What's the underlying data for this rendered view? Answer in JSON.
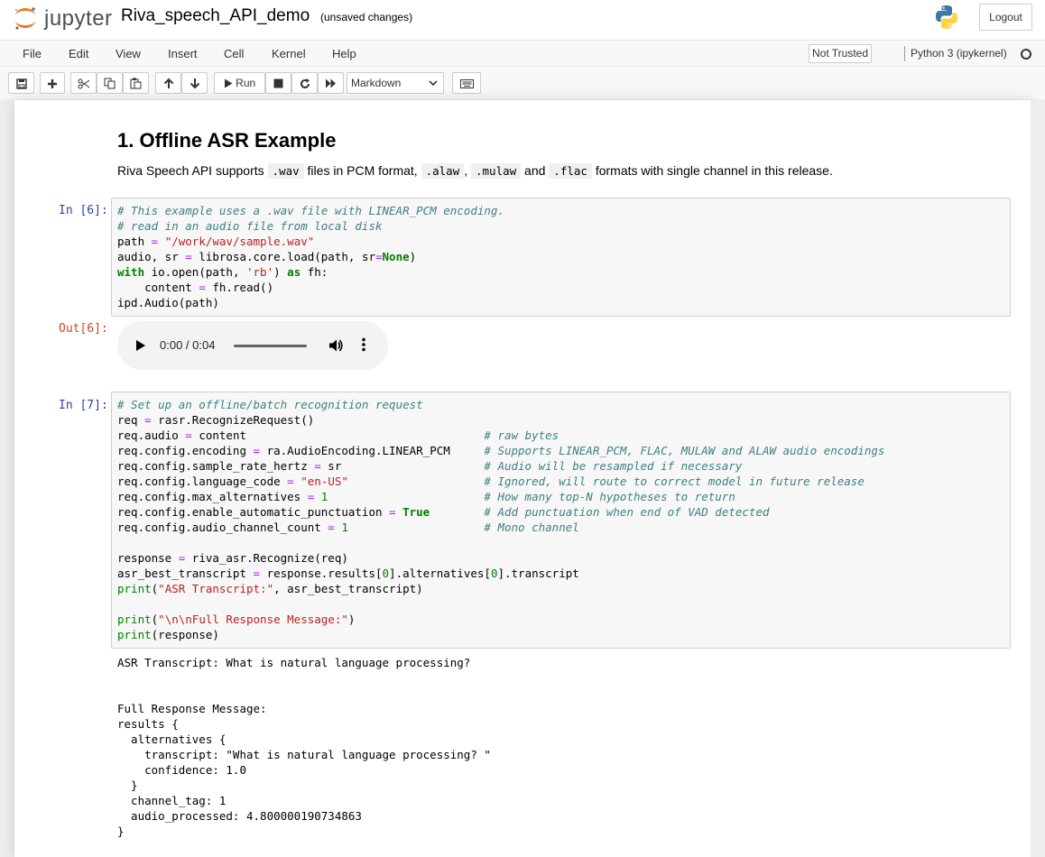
{
  "header": {
    "logo_text": "jupyter",
    "notebook_name": "Riva_speech_API_demo",
    "save_status": "(unsaved changes)",
    "logout_label": "Logout"
  },
  "menubar": {
    "items": [
      "File",
      "Edit",
      "View",
      "Insert",
      "Cell",
      "Kernel",
      "Help"
    ],
    "trust_label": "Not Trusted",
    "kernel_name": "Python 3 (ipykernel)"
  },
  "toolbar": {
    "run_label": "Run",
    "cell_type": "Markdown"
  },
  "markdown": {
    "title": "1. Offline ASR Example",
    "text_before": "Riva Speech API supports ",
    "code_wav": ".wav",
    "text_pcm": " files in PCM format, ",
    "code_alaw": ".alaw",
    "comma": ", ",
    "code_mulaw": ".mulaw",
    "and": " and ",
    "code_flac": ".flac",
    "text_after": " formats with single channel in this release."
  },
  "cells": {
    "cell6_prompt": "In [6]:",
    "cell6_out_prompt": "Out[6]:",
    "cell7_prompt": "In [7]:"
  },
  "audio": {
    "time": "0:00 / 0:04",
    "progress": 0
  },
  "output7": {
    "text": "ASR Transcript: What is natural language processing?\n\n\nFull Response Message:\nresults {\n  alternatives {\n    transcript: \"What is natural language processing? \"\n    confidence: 1.0\n  }\n  channel_tag: 1\n  audio_processed: 4.800000190734863\n}"
  },
  "colors": {
    "in_prompt": "#303f9f",
    "out_prompt": "#d84315",
    "comment": "#408080",
    "string": "#ba2121",
    "keyword": "#008000",
    "operator": "#aa22ff"
  }
}
